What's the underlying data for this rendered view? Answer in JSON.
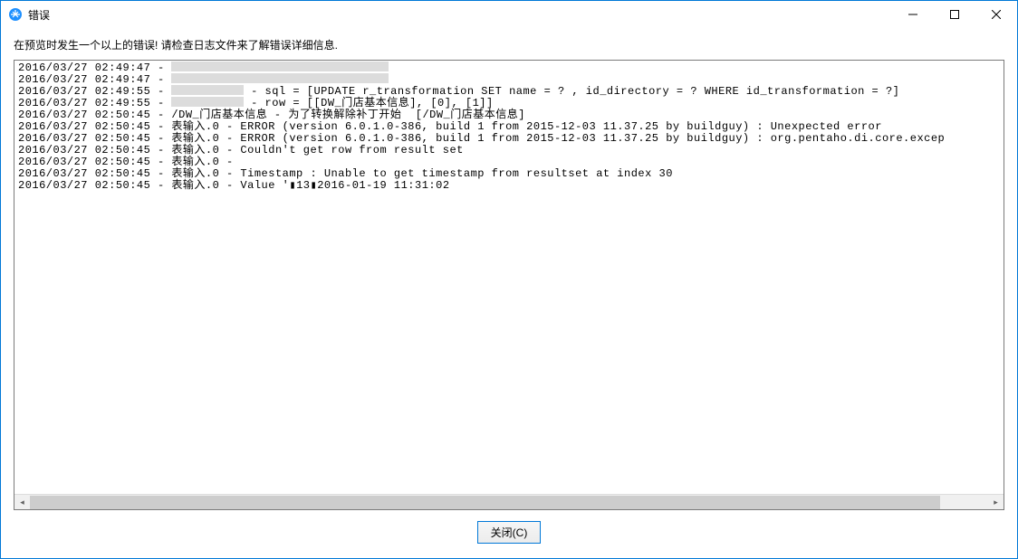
{
  "window": {
    "title": "错误"
  },
  "message": "在预览时发生一个以上的错误!  请检查日志文件来了解错误详细信息.",
  "log_lines": [
    {
      "prefix": "2016/03/27 02:49:47 - ",
      "redact_width": 240,
      "text": "                                                                                                                "
    },
    {
      "prefix": "2016/03/27 02:49:47 - ",
      "redact_width": 240,
      "text": ""
    },
    {
      "prefix": "2016/03/27 02:49:55 - ",
      "redact_width": 80,
      "text": " - sql = [UPDATE r_transformation SET name = ? , id_directory = ? WHERE id_transformation = ?]"
    },
    {
      "prefix": "2016/03/27 02:49:55 - ",
      "redact_width": 80,
      "text": " - row = [[DW_门店基本信息], [0], [1]]"
    },
    {
      "prefix": "2016/03/27 02:50:45 - /DW_门店基本信息 - 为了转换解除补丁开始  [/DW_门店基本信息]",
      "redact_width": 0,
      "text": ""
    },
    {
      "prefix": "2016/03/27 02:50:45 - 表输入.0 - ERROR (version 6.0.1.0-386, build 1 from 2015-12-03 11.37.25 by buildguy) : Unexpected error",
      "redact_width": 0,
      "text": ""
    },
    {
      "prefix": "2016/03/27 02:50:45 - 表输入.0 - ERROR (version 6.0.1.0-386, build 1 from 2015-12-03 11.37.25 by buildguy) : org.pentaho.di.core.excep",
      "redact_width": 0,
      "text": ""
    },
    {
      "prefix": "2016/03/27 02:50:45 - 表输入.0 - Couldn't get row from result set",
      "redact_width": 0,
      "text": ""
    },
    {
      "prefix": "2016/03/27 02:50:45 - 表输入.0 - ",
      "redact_width": 0,
      "text": ""
    },
    {
      "prefix": "2016/03/27 02:50:45 - 表输入.0 - Timestamp : Unable to get timestamp from resultset at index 30",
      "redact_width": 0,
      "text": ""
    },
    {
      "prefix": "2016/03/27 02:50:45 - 表输入.0 - Value '▮13▮2016-01-19 11:31:02",
      "redact_width": 0,
      "text": ""
    }
  ],
  "buttons": {
    "close": "关闭(C)"
  }
}
